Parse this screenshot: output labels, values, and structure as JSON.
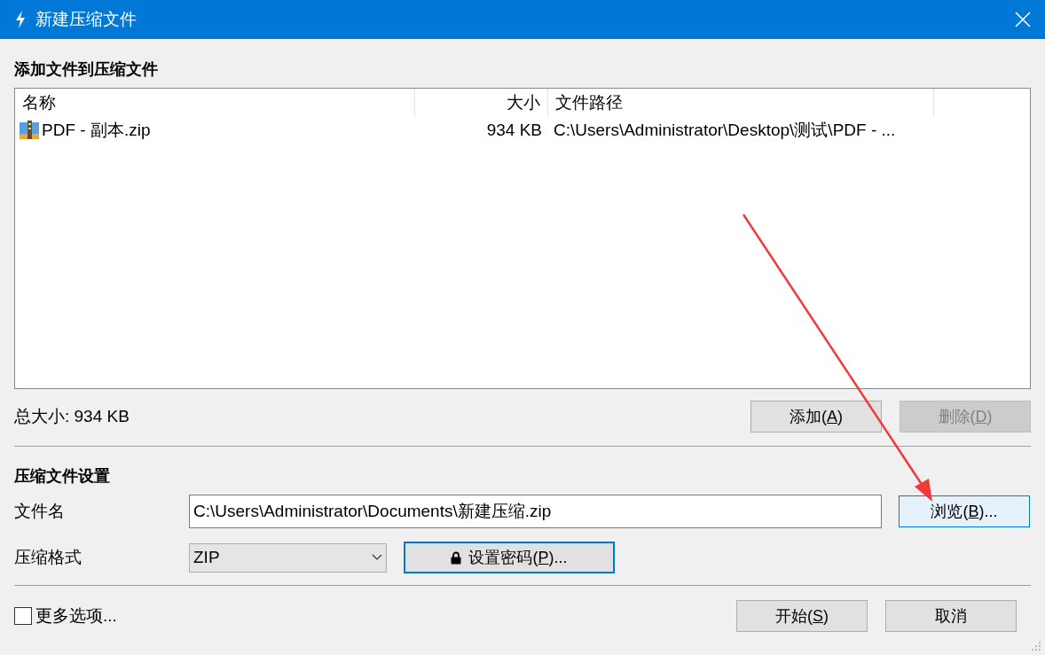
{
  "window": {
    "title": "新建压缩文件"
  },
  "files_section": {
    "heading": "添加文件到压缩文件",
    "columns": [
      {
        "label": "名称"
      },
      {
        "label": "大小"
      },
      {
        "label": "文件路径"
      }
    ],
    "rows": [
      {
        "name": "PDF - 副本.zip",
        "size": "934 KB",
        "path": "C:\\Users\\Administrator\\Desktop\\测试\\PDF - ..."
      }
    ],
    "total_size": "总大小: 934 KB",
    "buttons": [
      {
        "before": "添加(",
        "key": "A",
        "after": ")",
        "disabled": false,
        "highlighted": false,
        "default": false
      },
      {
        "before": "删除(",
        "key": "D",
        "after": ")",
        "disabled": true,
        "highlighted": false,
        "default": false
      }
    ]
  },
  "settings_section": {
    "heading": "压缩文件设置",
    "filename_label": "文件名",
    "filename_value": "C:\\Users\\Administrator\\Documents\\新建压缩.zip",
    "browse_button": {
      "before": "浏览(",
      "key": "B",
      "after": ")...",
      "disabled": false,
      "highlighted": true,
      "default": false
    },
    "format_label": "压缩格式",
    "format_value": "ZIP",
    "password_button": {
      "before": "设置密码(",
      "key": "P",
      "after": ")...",
      "disabled": false,
      "highlighted": false,
      "default": true
    }
  },
  "more_options": {
    "label": "更多选项...",
    "checked": false
  },
  "footer_buttons": [
    {
      "before": "开始(",
      "key": "S",
      "after": ")",
      "disabled": false,
      "highlighted": false,
      "default": false
    },
    {
      "before": "取消",
      "disabled": false,
      "highlighted": false,
      "default": false
    }
  ]
}
